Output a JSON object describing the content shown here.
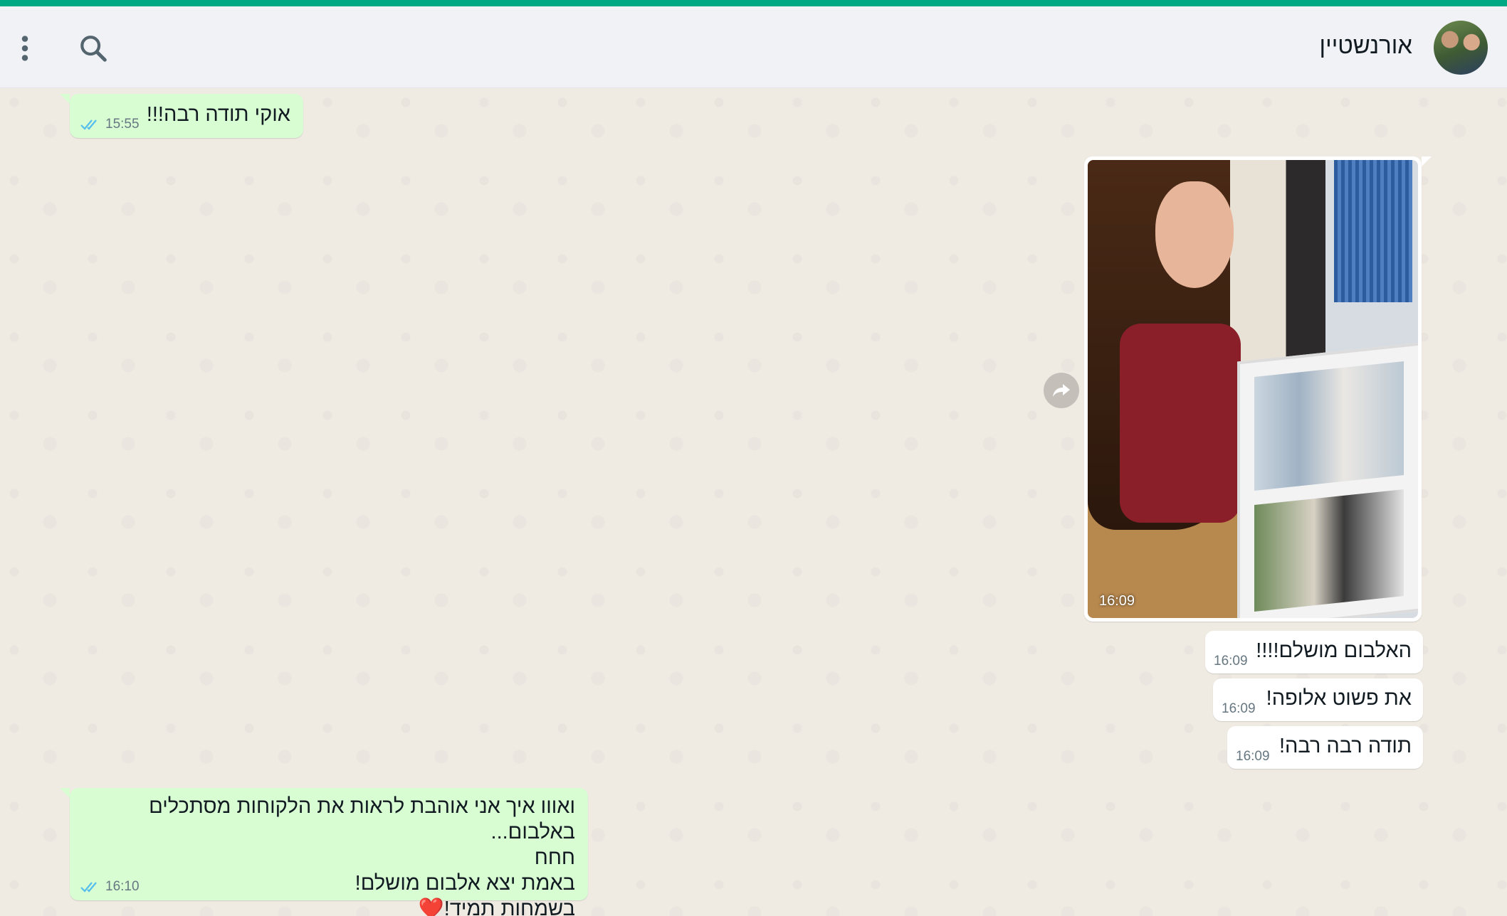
{
  "header": {
    "contact_name": "אורנשטיין"
  },
  "messages": [
    {
      "text": "אוקי תודה רבה!!!",
      "time": "15:55"
    },
    {
      "time": "16:09"
    },
    {
      "text": "האלבום מושלם!!!!",
      "time": "16:09"
    },
    {
      "text": "את פשוט אלופה!",
      "time": "16:09"
    },
    {
      "text": "תודה רבה רבה!",
      "time": "16:09"
    },
    {
      "text": "ואווו איך אני אוהבת לראות את הלקוחות מסתכלים באלבום...\nחחח\nבאמת יצא אלבום מושלם!\nבשמחות תמיד!❤️",
      "time": "16:10"
    }
  ],
  "colors": {
    "accent": "#00a884",
    "outgoing": "#d9fdd3",
    "incoming": "#ffffff",
    "read_ticks": "#53bdeb"
  },
  "icons": {
    "search": "search-icon",
    "menu": "more-vertical-icon",
    "forward": "forward-icon",
    "read": "double-check-icon"
  }
}
